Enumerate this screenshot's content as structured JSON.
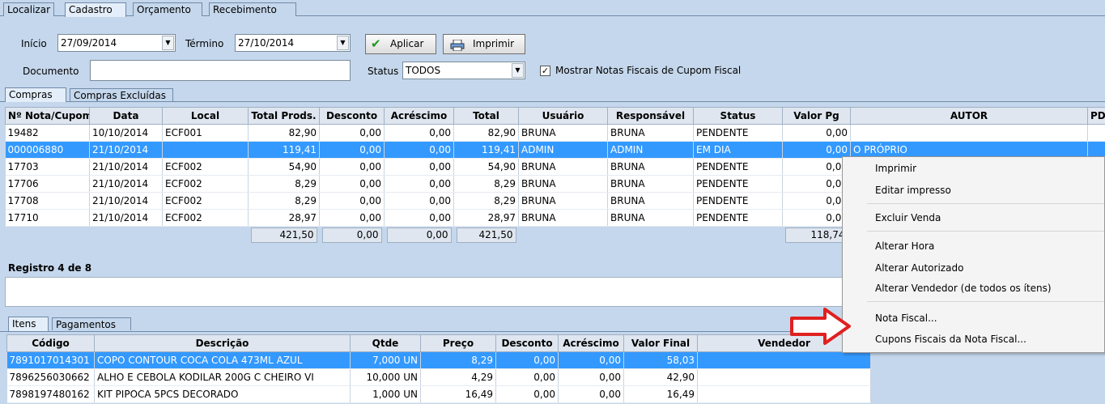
{
  "main_tabs": [
    "Localizar",
    "Cadastro",
    "Orçamento",
    "Recebimento"
  ],
  "filters": {
    "inicio_label": "Início",
    "inicio_value": "27/09/2014",
    "termino_label": "Término",
    "termino_value": "27/10/2014",
    "aplicar_label": "Aplicar",
    "imprimir_label": "Imprimir",
    "documento_label": "Documento",
    "documento_value": "",
    "status_label": "Status",
    "status_value": "TODOS",
    "mostrar_label": "Mostrar Notas Fiscais de Cupom Fiscal",
    "mostrar_checked": true
  },
  "sub_tabs": [
    "Compras",
    "Compras Excluídas"
  ],
  "compras": {
    "columns": [
      "Nº Nota/Cupom",
      "Data",
      "Local",
      "Total Prods.",
      "Desconto",
      "Acréscimo",
      "Total",
      "Usuário",
      "Responsável",
      "Status",
      "Valor Pg",
      "AUTOR",
      "PDV"
    ],
    "rows": [
      [
        "19482",
        "10/10/2014",
        "ECF001",
        "82,90",
        "0,00",
        "0,00",
        "82,90",
        "BRUNA",
        "BRUNA",
        "PENDENTE",
        "0,00",
        "",
        ""
      ],
      [
        "000006880",
        "21/10/2014",
        "",
        "119,41",
        "0,00",
        "0,00",
        "119,41",
        "ADMIN",
        "ADMIN",
        "EM DIA",
        "0,00",
        "O PRÓPRIO",
        ""
      ],
      [
        "17703",
        "21/10/2014",
        "ECF002",
        "54,90",
        "0,00",
        "0,00",
        "54,90",
        "BRUNA",
        "BRUNA",
        "PENDENTE",
        "0,00",
        "",
        ""
      ],
      [
        "17706",
        "21/10/2014",
        "ECF002",
        "8,29",
        "0,00",
        "0,00",
        "8,29",
        "BRUNA",
        "BRUNA",
        "PENDENTE",
        "0,00",
        "",
        ""
      ],
      [
        "17708",
        "21/10/2014",
        "ECF002",
        "8,29",
        "0,00",
        "0,00",
        "8,29",
        "BRUNA",
        "BRUNA",
        "PENDENTE",
        "0,00",
        "",
        ""
      ],
      [
        "17710",
        "21/10/2014",
        "ECF002",
        "28,97",
        "0,00",
        "0,00",
        "28,97",
        "BRUNA",
        "BRUNA",
        "PENDENTE",
        "0,00",
        "",
        ""
      ]
    ],
    "totals": {
      "total_prods": "421,50",
      "desconto": "0,00",
      "acrescimo": "0,00",
      "total": "421,50",
      "valor_pg": "118,74"
    },
    "selected_row": 1
  },
  "registro_label": "Registro 4 de 8",
  "bottom_tabs": [
    "Itens",
    "Pagamentos"
  ],
  "itens": {
    "columns": [
      "Código",
      "Descrição",
      "Qtde",
      "Preço",
      "Desconto",
      "Acréscimo",
      "Valor Final",
      "Vendedor"
    ],
    "rows": [
      [
        "7891017014301",
        "COPO CONTOUR COCA COLA 473ML AZUL",
        "7,000 UN",
        "8,29",
        "0,00",
        "0,00",
        "58,03",
        ""
      ],
      [
        "7896256030662",
        "ALHO E CEBOLA KODILAR 200G C CHEIRO VI",
        "10,000 UN",
        "4,29",
        "0,00",
        "0,00",
        "42,90",
        ""
      ],
      [
        "7898197480162",
        "KIT PIPOCA 5PCS DECORADO",
        "1,000 UN",
        "16,49",
        "0,00",
        "0,00",
        "16,49",
        ""
      ]
    ],
    "selected_row": 0
  },
  "context_menu": [
    "Imprimir",
    "Editar impresso",
    "Excluir Venda",
    "Alterar Hora",
    "Alterar Autorizado",
    "Alterar Vendedor (de todos os ítens)",
    "Nota Fiscal...",
    "Cupons Fiscais da Nota Fiscal..."
  ],
  "colors": {
    "selection": "#3399ff",
    "background": "#c5d7ec",
    "arrow": "#e02020"
  }
}
